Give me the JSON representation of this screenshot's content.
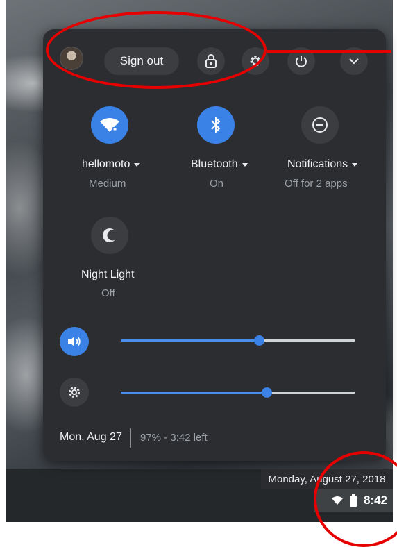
{
  "header": {
    "sign_out_label": "Sign out"
  },
  "features": [
    {
      "label": "hellomoto",
      "status": "Medium",
      "icon": "wifi-icon",
      "state": "on"
    },
    {
      "label": "Bluetooth",
      "status": "On",
      "icon": "bluetooth-icon",
      "state": "on"
    },
    {
      "label": "Notifications",
      "status": "Off for 2 apps",
      "icon": "do-not-disturb-icon",
      "state": "off"
    },
    {
      "label": "Night Light",
      "status": "Off",
      "icon": "night-light-icon",
      "state": "off"
    }
  ],
  "sliders": {
    "volume": {
      "level": 0.59,
      "icon": "volume-icon"
    },
    "brightness": {
      "level": 0.62,
      "icon": "brightness-icon"
    }
  },
  "footer": {
    "date": "Mon, Aug 27",
    "battery": "97% - 3:42 left"
  },
  "shelf": {
    "tooltip": "Monday, August 27, 2018",
    "time": "8:42"
  },
  "colors": {
    "panel_bg": "#2c2d30",
    "accent_blue": "#3b82e6",
    "annotation_red": "#e60000"
  }
}
